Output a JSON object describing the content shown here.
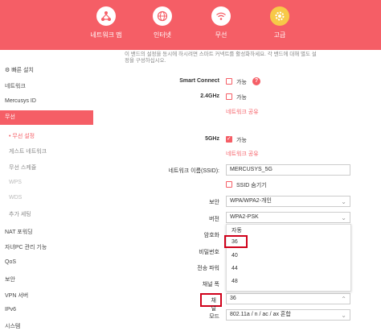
{
  "nav": {
    "items": [
      {
        "label": "네트워크 맵",
        "icon": "network-map-icon"
      },
      {
        "label": "인터넷",
        "icon": "globe-icon"
      },
      {
        "label": "무선",
        "icon": "wifi-icon"
      },
      {
        "label": "고급",
        "icon": "gear-icon"
      }
    ],
    "active_color": "#f7c948"
  },
  "sidebar": {
    "items": [
      {
        "label": "빠른 설치"
      },
      {
        "label": "네트워크"
      },
      {
        "label": "Mercusys ID"
      },
      {
        "label": "무선"
      },
      {
        "label": "• 무선 설정"
      },
      {
        "label": "게스트 네트워크"
      },
      {
        "label": "무선 스케쥴"
      },
      {
        "label": "WPS"
      },
      {
        "label": "WDS"
      },
      {
        "label": "추가 세팅"
      },
      {
        "label": "NAT 포워딩"
      },
      {
        "label": "자녀PC 관리 기능"
      },
      {
        "label": "QoS"
      },
      {
        "label": "보안"
      },
      {
        "label": "VPN 서버"
      },
      {
        "label": "IPv6"
      },
      {
        "label": "시스템"
      }
    ]
  },
  "main": {
    "desc_line1": "이 밴드의 설정을 동시에 하시려면 스마트 커넥트를 활성화하세요. 각 밴드에 대해 별도 설",
    "desc_line2": "정을 구성하십시오.",
    "smart_connect_label": "Smart Connect",
    "enable_label": "가능",
    "band24_label": "2.4GHz",
    "share_network": "네트워크 공유",
    "band5_label": "5GHz",
    "ssid_label": "네트워크 이름(SSID):",
    "ssid_value": "MERCUSYS_5G",
    "hide_ssid": "SSID 숨기기",
    "security_label": "보안",
    "security_value": "WPA/WPA2-개인",
    "version_label": "버전",
    "version_value": "WPA2-PSK",
    "encryption_label": "암호화",
    "password_label": "비밀번호",
    "tx_power_label": "전송 파워",
    "channel_width_label": "채널 폭",
    "channel_label": "채널",
    "channel_value": "36",
    "mode_label": "모드",
    "mode_value": "802.11a / n / ac / ax 혼합",
    "channel_options": [
      "자동",
      "36",
      "40",
      "44",
      "48"
    ],
    "highlight_color": "#d0021b"
  }
}
